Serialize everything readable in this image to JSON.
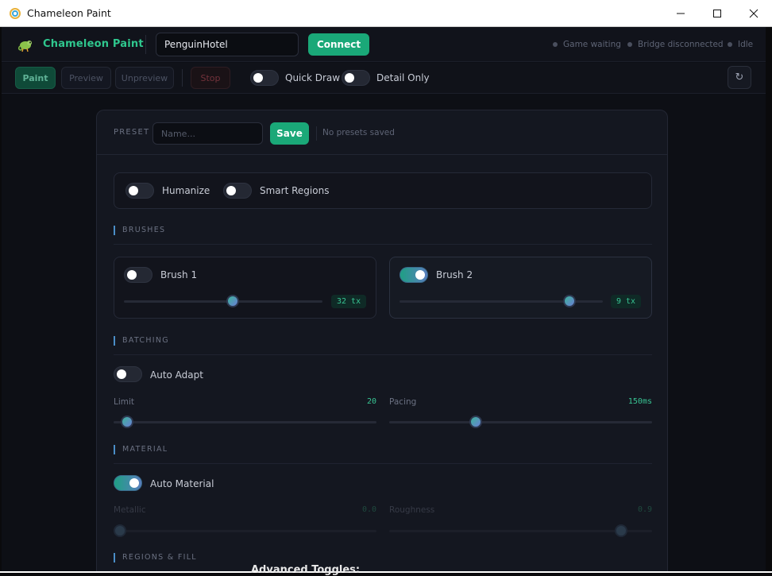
{
  "window": {
    "title": "Chameleon Paint"
  },
  "header": {
    "brand": "Chameleon Paint",
    "server_value": "PenguinHotel",
    "connect_label": "Connect",
    "status": [
      "Game waiting",
      "Bridge disconnected",
      "Idle"
    ]
  },
  "toolbar": {
    "paint": "Paint",
    "preview": "Preview",
    "unpreview": "Unpreview",
    "stop": "Stop",
    "quick_draw": {
      "label": "Quick Draw",
      "on": false
    },
    "detail_only": {
      "label": "Detail Only",
      "on": false
    },
    "refresh_glyph": "↻"
  },
  "preset": {
    "label": "PRESET",
    "placeholder": "Name...",
    "save": "Save",
    "empty": "No presets saved"
  },
  "general": {
    "humanize": {
      "label": "Humanize",
      "on": false
    },
    "smart_regions": {
      "label": "Smart Regions",
      "on": false
    }
  },
  "brushes": {
    "title": "BRUSHES",
    "brush1": {
      "label": "Brush 1",
      "on": false,
      "value": "32 tx",
      "level": 0.55
    },
    "brush2": {
      "label": "Brush 2",
      "on": true,
      "value": "9 tx",
      "level": 0.86
    }
  },
  "batching": {
    "title": "BATCHING",
    "auto_adapt": {
      "label": "Auto Adapt",
      "on": false
    },
    "limit": {
      "label": "Limit",
      "value": "20",
      "level": 0.03
    },
    "pacing": {
      "label": "Pacing",
      "value": "150ms",
      "level": 0.32
    }
  },
  "material": {
    "title": "MATERIAL",
    "auto_material": {
      "label": "Auto Material",
      "on": true
    },
    "metallic": {
      "label": "Metallic",
      "value": "0.0",
      "level": 0.0
    },
    "roughness": {
      "label": "Roughness",
      "value": "0.9",
      "level": 0.9
    }
  },
  "regions": {
    "title": "REGIONS & FILL"
  },
  "behind": {
    "advanced": "Advanced Toggles:"
  }
}
